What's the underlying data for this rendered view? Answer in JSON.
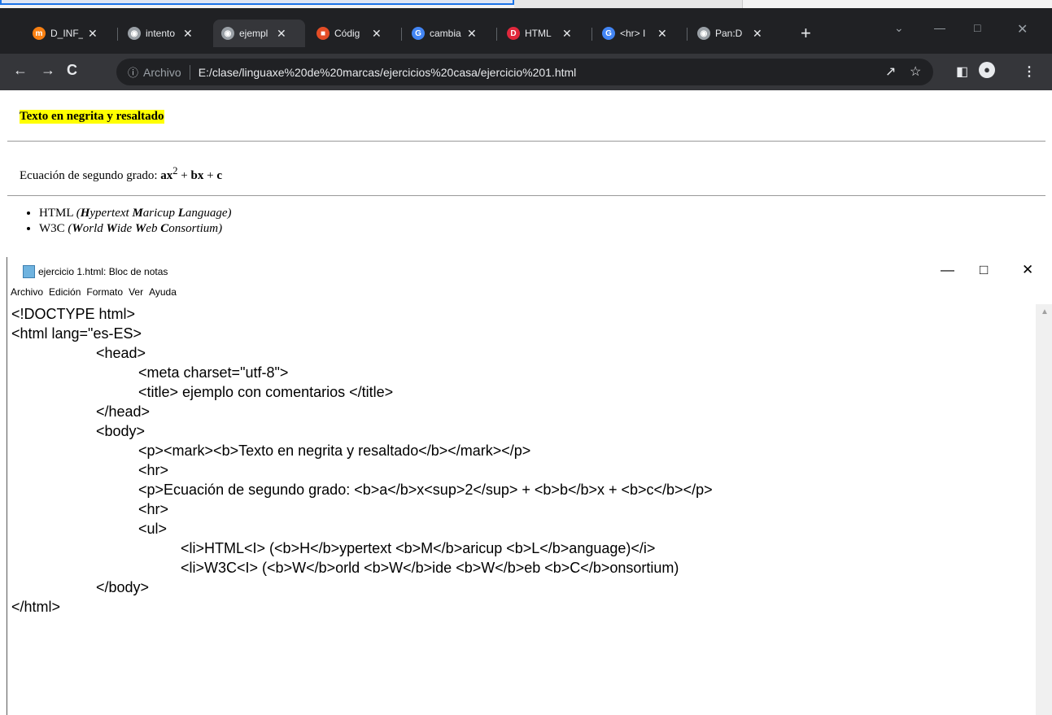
{
  "browser": {
    "tabs": [
      {
        "title": "D_INF_",
        "icon": "moodle-icon",
        "color": "#f98012",
        "active": false
      },
      {
        "title": "intento",
        "icon": "globe-icon",
        "color": "#9aa0a6",
        "active": false
      },
      {
        "title": "ejempl",
        "icon": "globe-icon",
        "color": "#9aa0a6",
        "active": true
      },
      {
        "title": "Códig",
        "icon": "code-icon",
        "color": "#e44d26",
        "active": false
      },
      {
        "title": "cambia",
        "icon": "google-icon",
        "color": "#4285f4",
        "active": false
      },
      {
        "title": "HTML",
        "icon": "d-icon",
        "color": "#e0283c",
        "active": false
      },
      {
        "title": "<hr> I",
        "icon": "google-icon",
        "color": "#4285f4",
        "active": false
      },
      {
        "title": "Pan:D",
        "icon": "globe-icon",
        "color": "#9aa0a6",
        "active": false
      }
    ],
    "new_tab": "+",
    "omnibox": {
      "info": "ⓘ",
      "scheme_label": "Archivo",
      "url": "E:/clase/linguaxe%20de%20marcas/ejercicios%20casa/ejercicio%201.html"
    }
  },
  "page": {
    "bold_text": "Texto en negrita y resaltado",
    "equation_prefix": "Ecuación de segundo grado: ",
    "eq_a": "a",
    "eq_x": "x",
    "eq_sup": "2",
    "eq_plus1": " + ",
    "eq_b": "b",
    "eq_x2": "x",
    "eq_plus2": " + ",
    "eq_c": "c",
    "list": [
      {
        "name": "HTML",
        "expansion": [
          [
            "H",
            "ypertext "
          ],
          [
            "M",
            "aricup "
          ],
          [
            "L",
            "anguage)"
          ]
        ]
      },
      {
        "name": "W3C",
        "expansion": [
          [
            "W",
            "orld "
          ],
          [
            "W",
            "ide "
          ],
          [
            "W",
            "eb "
          ],
          [
            "C",
            "onsortium)"
          ]
        ]
      }
    ]
  },
  "notepad": {
    "title": "ejercicio 1.html: Bloc de notas",
    "menu": [
      "Archivo",
      "Edición",
      "Formato",
      "Ver",
      "Ayuda"
    ],
    "lines": [
      "<!DOCTYPE html>",
      "<html lang=\"es-ES>",
      "\t\t<head>",
      "\t\t\t<meta charset=\"utf-8\">",
      "\t\t\t<title> ejemplo con comentarios </title>",
      "\t\t</head>",
      "\t\t<body>",
      "\t\t\t<p><mark><b>Texto en negrita y resaltado</b></mark></p>",
      "\t\t\t<hr>",
      "\t\t\t<p>Ecuación de segundo grado: <b>a</b>x<sup>2</sup> + <b>b</b>x + <b>c</b></p>",
      "\t\t\t<hr>",
      "\t\t\t<ul>",
      "\t\t\t\t<li>HTML<I> (<b>H</b>ypertext <b>M</b>aricup <b>L</b>anguage)</i>",
      "\t\t\t\t<li>W3C<I> (<b>W</b>orld <b>W</b>ide <b>W</b>eb <b>C</b>onsortium)",
      "\t\t</body>",
      "</html>"
    ]
  }
}
